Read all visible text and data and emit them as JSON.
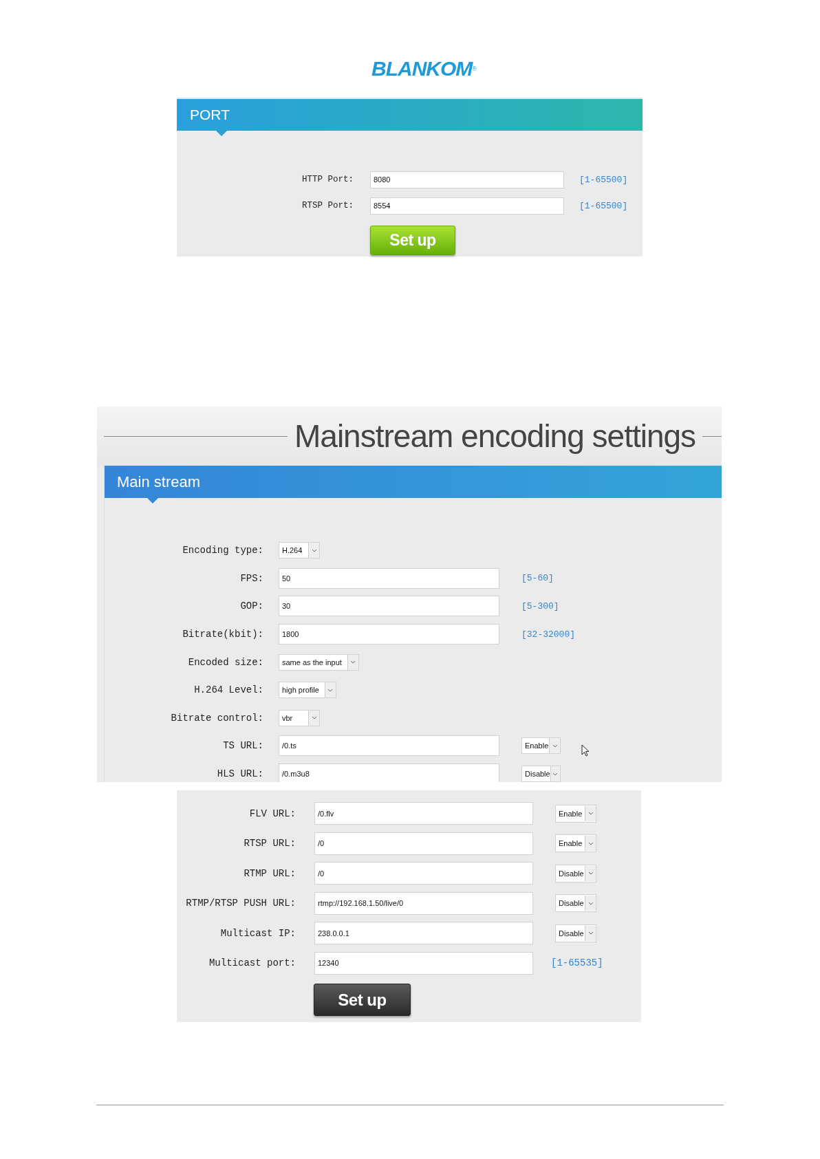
{
  "logo": {
    "text": "BLANKOM",
    "mark": "®"
  },
  "port_panel": {
    "title": "PORT",
    "rows": [
      {
        "label": "HTTP Port:",
        "value": "8080",
        "range": "[1-65500]"
      },
      {
        "label": "RTSP Port:",
        "value": "8554",
        "range": "[1-65500]"
      }
    ],
    "button": "Set up"
  },
  "main_screen": {
    "heading": "Mainstream encoding settings",
    "panel_title": "Main stream",
    "rows": [
      {
        "kind": "select",
        "label": "Encoding type:",
        "value": "H.264"
      },
      {
        "kind": "input",
        "label": "FPS:",
        "value": "50",
        "range": "[5-60]"
      },
      {
        "kind": "input",
        "label": "GOP:",
        "value": "30",
        "range": "[5-300]"
      },
      {
        "kind": "input",
        "label": "Bitrate(kbit):",
        "value": "1800",
        "range": "[32-32000]"
      },
      {
        "kind": "select",
        "label": "Encoded size:",
        "value": "same as the input"
      },
      {
        "kind": "select",
        "label": "H.264 Level:",
        "value": "high profile"
      },
      {
        "kind": "select",
        "label": "Bitrate control:",
        "value": "vbr"
      },
      {
        "kind": "input",
        "label": "TS URL:",
        "value": "/0.ts",
        "toggle": "Enable"
      },
      {
        "kind": "input",
        "label": "HLS URL:",
        "value": "/0.m3u8",
        "toggle": "Disable"
      }
    ]
  },
  "url_panel": {
    "rows": [
      {
        "label": "FLV URL:",
        "value": "/0.flv",
        "toggle": "Enable"
      },
      {
        "label": "RTSP URL:",
        "value": "/0",
        "toggle": "Enable"
      },
      {
        "label": "RTMP URL:",
        "value": "/0",
        "toggle": "Disable"
      },
      {
        "label": "RTMP/RTSP PUSH URL:",
        "value": "rtmp://192.168.1.50/live/0",
        "toggle": "Disable"
      },
      {
        "label": "Multicast IP:",
        "value": "238.0.0.1",
        "toggle": "Disable"
      },
      {
        "label": "Multicast port:",
        "value": "12340",
        "range": "[1-65535]"
      }
    ],
    "button": "Set up"
  }
}
